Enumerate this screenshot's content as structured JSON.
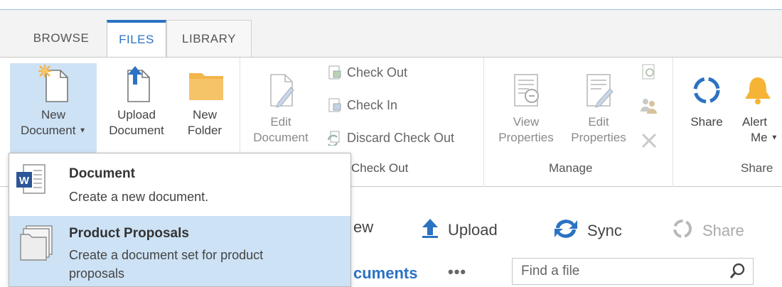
{
  "tabs": [
    {
      "label": "BROWSE"
    },
    {
      "label": "FILES"
    },
    {
      "label": "LIBRARY"
    }
  ],
  "ribbon": {
    "new_group": {
      "new_document": {
        "line1": "New",
        "line2": "Document"
      },
      "upload_document": {
        "line1": "Upload",
        "line2": "Document"
      },
      "new_folder": {
        "line1": "New",
        "line2": "Folder"
      }
    },
    "open_checkout_group": {
      "edit_document": {
        "line1": "Edit",
        "line2": "Document"
      },
      "check_out": "Check Out",
      "check_in": "Check In",
      "discard_check_out": "Discard Check Out",
      "label": "Check Out"
    },
    "manage_group": {
      "view_properties": {
        "line1": "View",
        "line2": "Properties"
      },
      "edit_properties": {
        "line1": "Edit",
        "line2": "Properties"
      },
      "label": "Manage"
    },
    "share_group": {
      "share": "Share",
      "alert_me": {
        "line1": "Alert",
        "line2": "Me"
      },
      "label": "Share"
    }
  },
  "dropdown": {
    "items": [
      {
        "title": "Document",
        "description": "Create a new document."
      },
      {
        "title": "Product Proposals",
        "description": "Create a document set for product proposals"
      }
    ]
  },
  "commands": {
    "new_partial": "ew",
    "upload": "Upload",
    "sync": "Sync",
    "share": "Share"
  },
  "view": {
    "documents_partial": "cuments",
    "ellipsis": "•••"
  },
  "search": {
    "placeholder": "Find a file"
  },
  "colors": {
    "accent": "#2b72c2",
    "highlight": "#cde2f5",
    "folder": "#f2b54a",
    "bell": "#f5b435"
  }
}
